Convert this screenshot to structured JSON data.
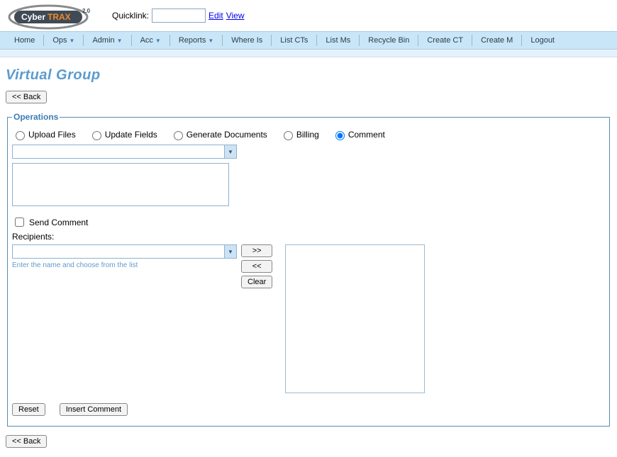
{
  "logo": {
    "brand_left": "Cyber",
    "brand_right": "TRAX",
    "version": "2.0"
  },
  "quicklink": {
    "label": "Quicklink:",
    "edit": "Edit",
    "view": "View"
  },
  "nav": {
    "home": "Home",
    "ops": "Ops",
    "admin": "Admin",
    "acc": "Acc",
    "reports": "Reports",
    "whereis": "Where Is",
    "listcts": "List CTs",
    "listms": "List Ms",
    "recycle": "Recycle Bin",
    "createct": "Create CT",
    "createm": "Create M",
    "logout": "Logout"
  },
  "page_title": "Virtual Group",
  "back_label": "<< Back",
  "ops": {
    "legend": "Operations",
    "radios": {
      "upload": "Upload Files",
      "update": "Update Fields",
      "generate": "Generate Documents",
      "billing": "Billing",
      "comment": "Comment"
    },
    "send_comment": "Send Comment",
    "recipients_label": "Recipients:",
    "recipients_hint": "Enter the name and choose from the list",
    "btn_add": ">>",
    "btn_remove": "<<",
    "btn_clear": "Clear",
    "btn_reset": "Reset",
    "btn_insert": "Insert Comment"
  }
}
